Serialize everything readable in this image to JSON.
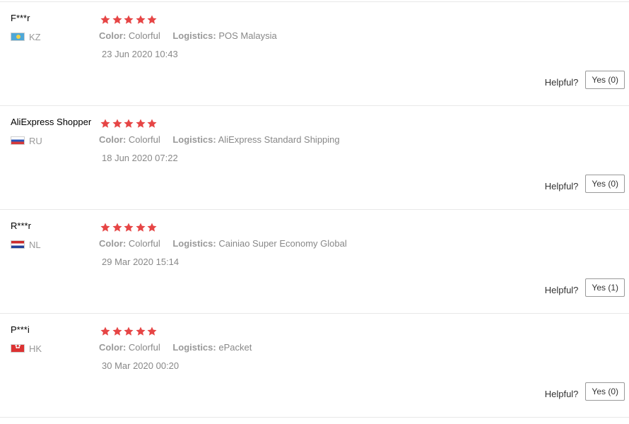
{
  "colors": {
    "star": "#e64545",
    "separator": "#e8e8e8",
    "muted_text": "#999999"
  },
  "labels": {
    "color": "Color:",
    "logistics": "Logistics:",
    "helpful": "Helpful?"
  },
  "reviews": [
    {
      "user": "F***r",
      "flag_icon": "kz-flag-icon",
      "country": "KZ",
      "rating": 5,
      "color": "Colorful",
      "logistics": "POS Malaysia",
      "date": "23 Jun 2020 10:43",
      "helpful_yes": "Yes (0)"
    },
    {
      "user": "AliExpress Shopper",
      "flag_icon": "ru-flag-icon",
      "country": "RU",
      "rating": 5,
      "color": "Colorful",
      "logistics": "AliExpress Standard Shipping",
      "date": "18 Jun 2020 07:22",
      "helpful_yes": "Yes (0)"
    },
    {
      "user": "R***r",
      "flag_icon": "nl-flag-icon",
      "country": "NL",
      "rating": 5,
      "color": "Colorful",
      "logistics": "Cainiao Super Economy Global",
      "date": "29 Mar 2020 15:14",
      "helpful_yes": "Yes (1)"
    },
    {
      "user": "P***i",
      "flag_icon": "hk-flag-icon",
      "country": "HK",
      "rating": 5,
      "color": "Colorful",
      "logistics": "ePacket",
      "date": "30 Mar 2020 00:20",
      "helpful_yes": "Yes (0)"
    }
  ]
}
